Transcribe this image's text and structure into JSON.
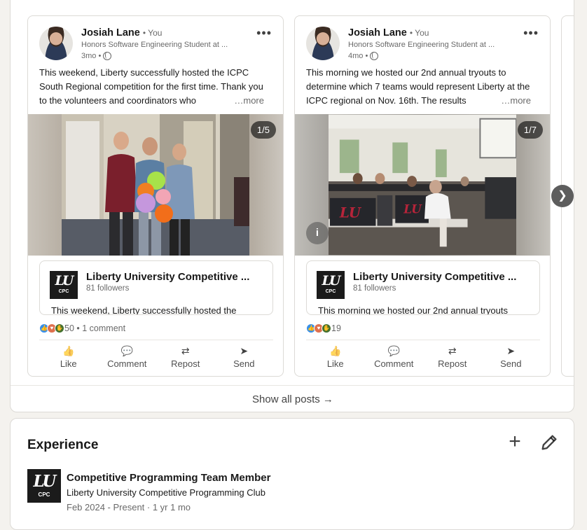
{
  "posts": [
    {
      "author": "Josiah Lane",
      "you_label": "• You",
      "headline": "Honors Software Engineering Student at ...",
      "time": "3mo •",
      "text": "This weekend, Liberty successfully hosted the ICPC South Regional competition for the first time. Thank you to the volunteers and coordinators who",
      "more": "…more",
      "media_counter": "1/5",
      "org_name": "Liberty University Competitive ...",
      "org_followers": "81 followers",
      "org_snippet": "This weekend, Liberty successfully hosted the",
      "reaction_count": "50",
      "comments": "• 1 comment"
    },
    {
      "author": "Josiah Lane",
      "you_label": "• You",
      "headline": "Honors Software Engineering Student at ...",
      "time": "4mo •",
      "text": "This morning we hosted our 2nd annual tryouts to determine which 7 teams would represent Liberty at the ICPC regional on Nov. 16th. The results",
      "more": "…more",
      "media_counter": "1/7",
      "org_name": "Liberty University Competitive ...",
      "org_followers": "81 followers",
      "org_snippet": "This morning we hosted our 2nd annual tryouts",
      "reaction_count": "19",
      "comments": ""
    }
  ],
  "logo": {
    "lu": "LU",
    "cpc": "CPC"
  },
  "actions": {
    "like": "Like",
    "comment": "Comment",
    "repost": "Repost",
    "send": "Send"
  },
  "icons": {
    "more": "ellipsis-icon",
    "visibility": "globe-icon",
    "next": "chevron-right-icon",
    "alt": "info-icon"
  },
  "show_all_posts": "Show all posts →",
  "experience": {
    "title": "Experience",
    "role": "Competitive Programming Team Member",
    "org": "Liberty University Competitive Programming Club",
    "dates": "Feb 2024 - Present · 1 yr 1 mo"
  },
  "colors": {
    "like": "#378fe9",
    "love": "#df704d",
    "celebrate": "#44712e",
    "logo_bg": "#1b1b1b"
  }
}
